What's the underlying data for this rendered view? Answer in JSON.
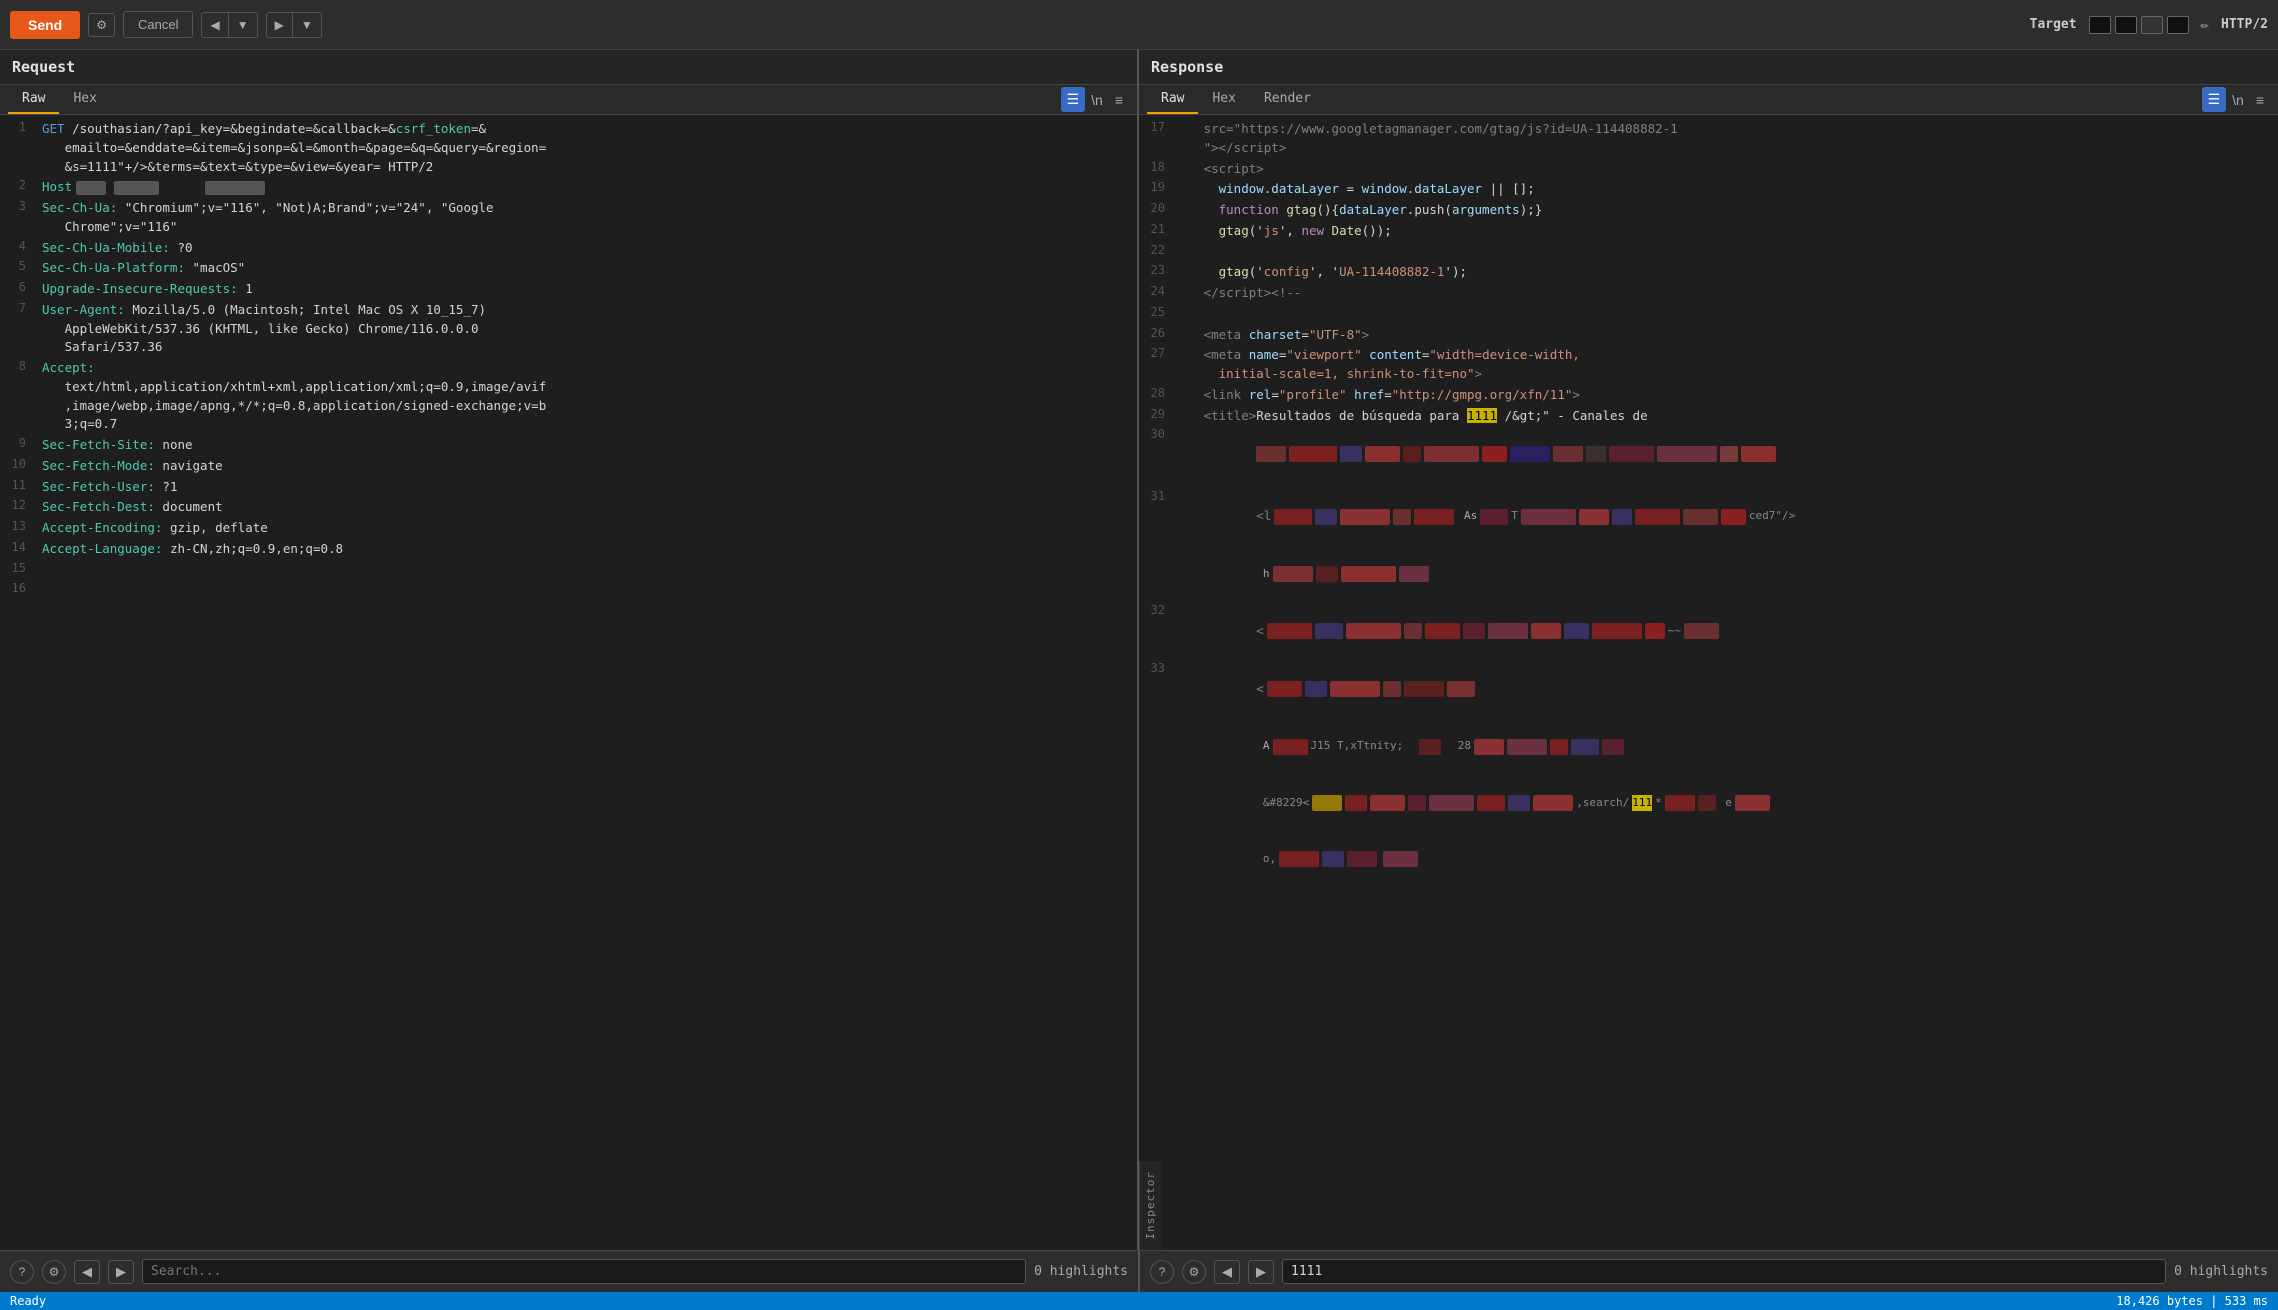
{
  "toolbar": {
    "send_label": "Send",
    "cancel_label": "Cancel",
    "target_label": "Target",
    "http_version": "HTTP/2",
    "edit_icon": "✏"
  },
  "request": {
    "panel_title": "Request",
    "tabs": [
      "Raw",
      "Hex"
    ],
    "active_tab": "Raw"
  },
  "response": {
    "panel_title": "Response",
    "tabs": [
      "Raw",
      "Hex",
      "Render"
    ],
    "active_tab": "Raw"
  },
  "request_lines": [
    {
      "num": 1,
      "type": "request_line"
    },
    {
      "num": 2,
      "type": "host_line"
    },
    {
      "num": 3,
      "type": "sec_ua_line1"
    },
    {
      "num": 4,
      "type": "sec_ua_mobile"
    },
    {
      "num": 5,
      "type": "sec_ua_platform"
    },
    {
      "num": 6,
      "type": "upgrade_insecure"
    },
    {
      "num": 7,
      "type": "user_agent1"
    },
    {
      "num": 8,
      "type": "accept"
    },
    {
      "num": 9,
      "type": "sec_fetch_site"
    },
    {
      "num": 10,
      "type": "sec_fetch_mode"
    },
    {
      "num": 11,
      "type": "sec_fetch_user"
    },
    {
      "num": 12,
      "type": "sec_fetch_dest"
    },
    {
      "num": 13,
      "type": "accept_encoding"
    },
    {
      "num": 14,
      "type": "accept_language"
    },
    {
      "num": 15,
      "type": "empty"
    },
    {
      "num": 16,
      "type": "empty"
    }
  ],
  "response_lines": [
    {
      "num": 17,
      "type": "script_src"
    },
    {
      "num": 18,
      "type": "script_open"
    },
    {
      "num": 19,
      "type": "window_datalayer"
    },
    {
      "num": 20,
      "type": "function_gtag"
    },
    {
      "num": 21,
      "type": "gtag_js"
    },
    {
      "num": 22,
      "type": "empty"
    },
    {
      "num": 23,
      "type": "gtag_config"
    },
    {
      "num": 24,
      "type": "script_close"
    },
    {
      "num": 25,
      "type": "empty"
    },
    {
      "num": 26,
      "type": "meta_charset"
    },
    {
      "num": 27,
      "type": "meta_viewport"
    },
    {
      "num": 28,
      "type": "link_profile"
    },
    {
      "num": 29,
      "type": "title_tag"
    },
    {
      "num": 30,
      "type": "mosaic1"
    },
    {
      "num": 31,
      "type": "mosaic2"
    },
    {
      "num": 32,
      "type": "mosaic3"
    },
    {
      "num": 33,
      "type": "mosaic4"
    }
  ],
  "bottom_left": {
    "search_placeholder": "Search...",
    "highlights_count": "0 highlights"
  },
  "bottom_right": {
    "search_value": "1111",
    "highlights_count": "0 highlights"
  },
  "status_bar": {
    "ready_text": "Ready",
    "bytes_info": "18,426 bytes | 533 ms"
  }
}
